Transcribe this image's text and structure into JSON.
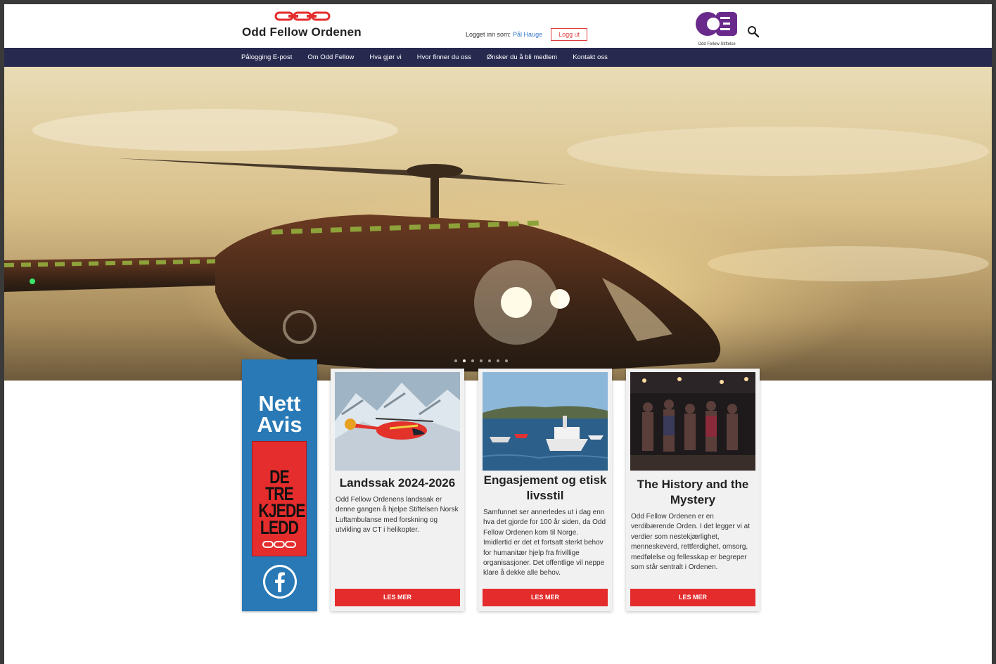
{
  "header": {
    "site_name": "Odd Fellow Ordenen",
    "login_prefix": "Logget inn som:",
    "login_user": "Pål Hauge",
    "logout_label": "Logg ut",
    "stiftelse_label": "Odd Fellow Stiftelse"
  },
  "nav": {
    "items": [
      "Pålogging E-post",
      "Om Odd Fellow",
      "Hva gjør vi",
      "Hvor finner du oss",
      "Ønsker du å bli medlem",
      "Kontakt oss"
    ]
  },
  "hero": {
    "slide_count": 7,
    "active_slide": 2
  },
  "avis": {
    "title_line1": "Nett",
    "title_line2": "Avis",
    "poster_line1": "DE TRE",
    "poster_line2": "KJEDE",
    "poster_line3": "LEDD"
  },
  "cards": [
    {
      "title": "Landssak 2024-2026",
      "text": "Odd Fellow Ordenens landssak er denne gangen å hjelpe Stiftelsen Norsk Luftambulanse med forskning og utvikling av CT i helikopter.",
      "button": "LES MER"
    },
    {
      "title": "Engasjement og etisk livsstil",
      "text": "Samfunnet ser annerledes ut i dag enn hva det gjorde for 100 år siden, da Odd Fellow Ordenen kom til Norge. Imidlertid er det et fortsatt sterkt behov for humanitær hjelp fra frivillige organisasjoner. Det offentlige vil neppe klare å dekke alle behov.",
      "button": "LES MER"
    },
    {
      "title": "The History and the Mystery",
      "text": "Odd Fellow Ordenen er en verdibærende Orden. I det legger vi at verdier som nestekjærlighet, menneskeverd, rettferdighet, omsorg, medfølelse og fellesskap er begreper som står sentralt i Ordenen.",
      "button": "LES MER"
    }
  ],
  "colors": {
    "nav_bg": "#27294f",
    "accent_red": "#e42c2c",
    "avis_blue": "#2879b5",
    "stiftelse_purple": "#6a2a8c"
  }
}
